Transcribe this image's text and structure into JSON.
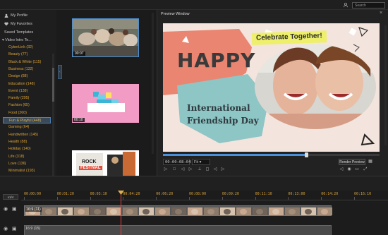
{
  "topbar": {
    "search_placeholder": "Search",
    "icons": [
      "profile-icon",
      "minimize-icon"
    ]
  },
  "left_panel": {
    "my_profile": "My Profile",
    "my_favorites": "My Favorites",
    "saved_templates": "Saved Templates",
    "video_intro": "Video Intro Te...",
    "categories": [
      "CyberLink (32)",
      "Beauty (77)",
      "Black & White (115)",
      "Business (132)",
      "Design (88)",
      "Education (148)",
      "Event (138)",
      "Family (295)",
      "Fashion (65)",
      "Food (260)",
      "Fun & Playful (448)",
      "Gaming (64)",
      "Handwritten (145)",
      "Health (88)",
      "Holiday (140)",
      "Life (318)",
      "Love (136)",
      "Minimalist (193)"
    ],
    "selected_index": 10
  },
  "media": {
    "thumbs": [
      {
        "duration": "00:07"
      },
      {
        "duration": "00:10"
      },
      {
        "duration": "",
        "text1": "ROCK",
        "text2": "FESTIVAL"
      }
    ]
  },
  "preview": {
    "window_title": "Preview Window",
    "timecode": "00:00:08:04",
    "fit": "Fit",
    "render_label": "Render Preview",
    "progress": 0.66,
    "canvas": {
      "happy": "HAPPY",
      "celebrate": "Celebrate Together!",
      "title_line1": "International",
      "title_line2": "Friendship Day"
    },
    "colors": {
      "coral": "#e98570",
      "teal": "#8ec5c5",
      "yellow": "#eeef6b",
      "bg": "#f3e5de"
    }
  },
  "timeline": {
    "zoom": "x1/4",
    "ruler": [
      "00:00:00",
      "00:01:20",
      "00:03:10",
      "00:04:20",
      "00:06:20",
      "00:08:00",
      "00:09:20",
      "00:11:10",
      "00:13:00",
      "00:14:20",
      "00:16:10"
    ],
    "track1_label": "16:9 (11)",
    "track2_label": "16:9 (15)"
  }
}
